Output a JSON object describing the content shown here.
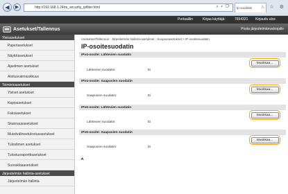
{
  "browser": {
    "back_glyph": "◀",
    "forward_glyph": "▶",
    "url": "http://192.168.1.24/m_security_ipfilter.html",
    "address_icons": "⌕ ▾ ⟳",
    "tab_label": "Ip-suodatin",
    "window_icons": "⌂ ☆ ⚙"
  },
  "app": {
    "top_links": [
      "Portaalilin",
      "Kirjaa käyttäjä:",
      "7654321",
      "Kirjaudu ulos"
    ],
    "title": "Asetukset/Tallennus",
    "admin_link": "Posta järjestelmänvalvojalle"
  },
  "sidebar": {
    "section1": "Yleisasetukset",
    "group1": [
      "Paperiasetukset",
      "Näyttöasetukset",
      "Ajastimen asetukset",
      "Aloitusvalmiuskkuus"
    ],
    "section2": "Toimintoasetukset",
    "group2": [
      "Yleiset asetukset",
      "Kopioasetukset",
      "Faksiasetukset",
      "Skannausasetukset",
      "Muistivälineetulostusasetukset",
      "Tulostimen asetukset",
      "Tulostusraporttiasetukset",
      "Suoraklaaasetukset"
    ],
    "section3": "Järjestelmän hallinta-asetukset",
    "group3": [
      "Järjestelmän hallinta"
    ]
  },
  "main": {
    "breadcrumb": "Asetukset/Tallennus : Järjestelmän hallinta-asetukset : Suojausasetukset > IP-osoitesuodatin",
    "title": "IP-osoitesuodatin",
    "panels": [
      {
        "header": "IPv4-osoite: Lähtevien suodatin",
        "label": "Lähtevien suodatin:",
        "value": "Ei",
        "button": "Muokkaa..."
      },
      {
        "header": "IPv4-osoite: Saapuvien suodatin",
        "label": "Saapuvien suodatin:",
        "value": "Ei",
        "button": "Muokkaa..."
      },
      {
        "header": "IPv6-osoite: Lähtevien suodatin",
        "label": "Lähtevien suodatin:",
        "value": "Ei",
        "button": "Muokkaa..."
      },
      {
        "header": "IPv6-osoite: Saapuvien suodatin",
        "label": "Saapuvien suodatin:",
        "value": "Ei",
        "button": "Muokkaa..."
      }
    ],
    "top_glyph": "⮝"
  },
  "colors": {
    "header_bg": "#3a3a3a",
    "button_highlight": "#f3a21b",
    "panel_header_bg": "#e3e3e3"
  }
}
